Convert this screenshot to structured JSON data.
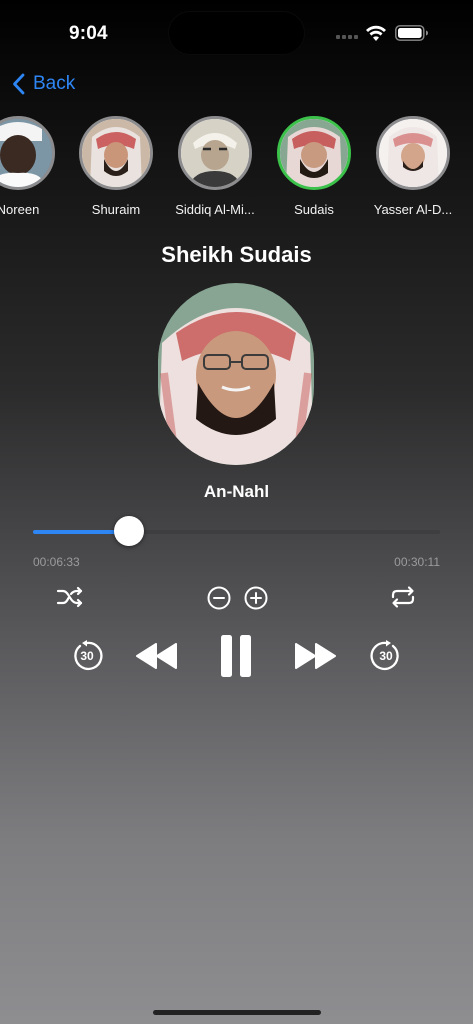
{
  "status_bar": {
    "time": "9:04"
  },
  "nav": {
    "back_label": "Back"
  },
  "reciters": [
    {
      "name": "Noreen",
      "selected": false
    },
    {
      "name": "Shuraim",
      "selected": false
    },
    {
      "name": "Siddiq Al-Mi...",
      "selected": false
    },
    {
      "name": "Sudais",
      "selected": true
    },
    {
      "name": "Yasser Al-D...",
      "selected": false
    }
  ],
  "player": {
    "title": "Sheikh Sudais",
    "surah": "An-Nahl",
    "elapsed": "00:06:33",
    "duration": "00:30:11",
    "progress_fraction": 0.235,
    "skip_back_seconds": "30",
    "skip_forward_seconds": "30"
  },
  "colors": {
    "accent": "#2e86f5",
    "selected_ring": "#3cc24a",
    "ring": "#8c8c8e"
  },
  "icons": {
    "shuffle": "shuffle-icon",
    "speed_down": "minus-circle-icon",
    "speed_up": "plus-circle-icon",
    "repeat": "repeat-icon",
    "skip_back": "skip-back-30-icon",
    "rewind": "rewind-icon",
    "pause": "pause-icon",
    "fast_forward": "fast-forward-icon",
    "skip_forward": "skip-forward-30-icon"
  }
}
